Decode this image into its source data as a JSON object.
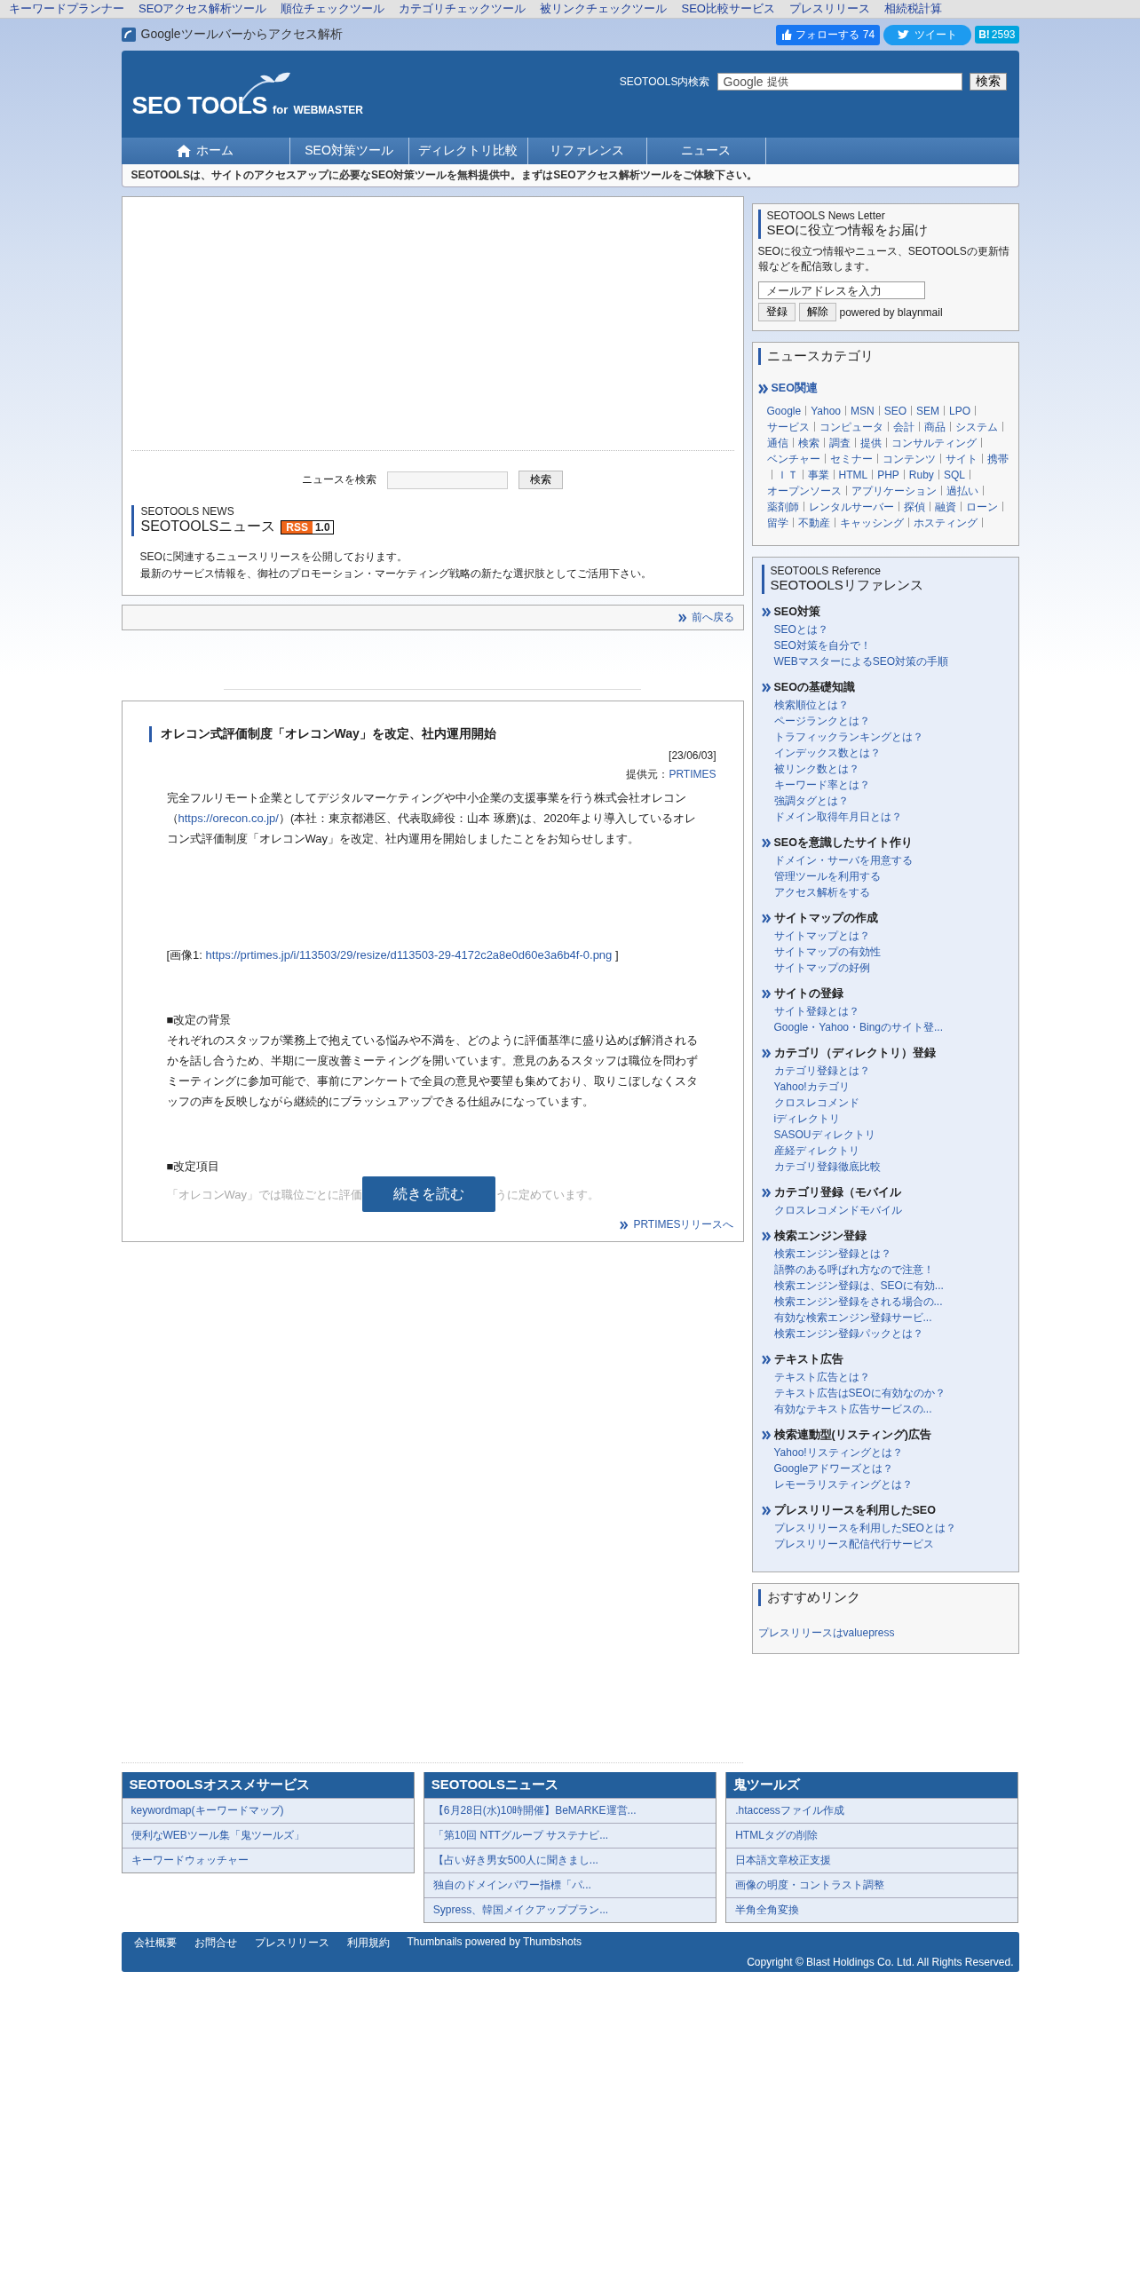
{
  "top_links": [
    "キーワードプランナー",
    "SEOアクセス解析ツール",
    "順位チェックツール",
    "カテゴリチェックツール",
    "被リンクチェックツール",
    "SEO比較サービス",
    "プレスリリース",
    "相続税計算"
  ],
  "toolbar_link": "Googleツールバーからアクセス解析",
  "social": {
    "follow": "フォローする",
    "follow_count": "74",
    "tweet": "ツイート",
    "hatena": "B!",
    "hatena_count": "2593"
  },
  "header": {
    "logo_main": "SEO TOOLS",
    "logo_for": "for",
    "logo_sub": "WEBMASTER",
    "search_label": "SEOTOOLS内検索",
    "search_brand": "Google",
    "search_brand_note": "提供",
    "search_button": "検索"
  },
  "nav": [
    {
      "label": "ホーム",
      "kind": "home"
    },
    {
      "label": "SEO対策ツール",
      "kind": "link"
    },
    {
      "label": "ディレクトリ比較",
      "kind": "link"
    },
    {
      "label": "リファレンス",
      "kind": "link"
    },
    {
      "label": "ニュース",
      "kind": "link"
    }
  ],
  "tagline": "SEOTOOLSは、サイトのアクセスアップに必要なSEO対策ツールを無料提供中。まずはSEOアクセス解析ツールをご体験下さい。",
  "news_panel": {
    "search_label": "ニュースを検索",
    "search_button": "検索",
    "kicker": "SEOTOOLS NEWS",
    "title": "SEOTOOLSニュース",
    "rss": "RSS",
    "rss_version": "1.0",
    "intro": [
      "SEOに関連するニュースリリースを公開しております。",
      "最新のサービス情報を、御社のプロモーション・マーケティング戦略の新たな選択肢としてご活用下さい。"
    ],
    "back_link": "前へ戻る"
  },
  "article": {
    "title": "オレコン式評価制度「オレコンWay」を改定、社内運用開始",
    "date": "[23/06/03]",
    "source_label": "提供元：",
    "source": "PRTIMES",
    "blocks": [
      {
        "kind": "text",
        "parts": [
          {
            "text": "完全フルリモート企業としてデジタルマーケティングや中小企業の支援事業を行う株式会社オレコン（",
            "link": false
          },
          {
            "text": "https://orecon.co.jp/",
            "link": true
          },
          {
            "text": "）(本社：東京都港区、代表取締役：山本 琢磨)は、2020年より導入しているオレコン式評価制度「オレコンWay」を改定、社内運用を開始しましたことをお知らせします。",
            "link": false
          }
        ]
      },
      {
        "kind": "image_ref",
        "parts": [
          {
            "text": "[画像1: ",
            "link": false
          },
          {
            "text": "https://prtimes.jp/i/113503/29/resize/d113503-29-4172c2a8e0d60e3a6b4f-0.png",
            "link": true
          },
          {
            "text": " ]",
            "link": false
          }
        ]
      },
      {
        "kind": "heading",
        "parts": [
          {
            "text": "■改定の背景",
            "link": false
          }
        ]
      },
      {
        "kind": "text",
        "parts": [
          {
            "text": "それぞれのスタッフが業務上で抱えている悩みや不満を、どのように評価基準に盛り込めば解消されるかを話し合うため、半期に一度改善ミーティングを開いています。意見のあるスタッフは職位を問わずミーティングに参加可能で、事前にアンケートで全員の意見や要望も集めており、取りこぼしなくスタッフの声を反映しながら継続的にブラッシュアップできる仕組みになっています。",
            "link": false
          }
        ]
      },
      {
        "kind": "heading",
        "parts": [
          {
            "text": "■改定項目",
            "link": false
          }
        ]
      }
    ],
    "fade_before": "「オレコンWay」では職位ごとに評価",
    "fade_after": "うに定めています。",
    "read_more": "続きを読む",
    "more_link": "PRTIMESリリースへ"
  },
  "newsletter": {
    "kicker": "SEOTOOLS News Letter",
    "title": "SEOに役立つ情報をお届け",
    "description": "SEOに役立つ情報やニュース、SEOTOOLSの更新情報などを配信致します。",
    "email_placeholder": "メールアドレスを入力",
    "buttons": [
      "登録",
      "解除"
    ],
    "powered": "powered by blaynmail"
  },
  "categories": {
    "title": "ニュースカテゴリ",
    "group": "SEO関連",
    "tags": [
      "Google",
      "Yahoo",
      "MSN",
      "SEO",
      "SEM",
      "LPO",
      "サービス",
      "コンピュータ",
      "会計",
      "商品",
      "システム",
      "通信",
      "検索",
      "調査",
      "提供",
      "コンサルティング",
      "ベンチャー",
      "セミナー",
      "コンテンツ",
      "サイト",
      "携帯",
      "ＩＴ",
      "事業",
      "HTML",
      "PHP",
      "Ruby",
      "SQL",
      "オープンソース",
      "アプリケーション",
      "過払い",
      "薬剤師",
      "レンタルサーバー",
      "探偵",
      "融資",
      "ローン",
      "留学",
      "不動産",
      "キャッシング",
      "ホスティング"
    ]
  },
  "reference": {
    "kicker": "SEOTOOLS Reference",
    "title": "SEOTOOLSリファレンス",
    "sections": [
      {
        "heading": "SEO対策",
        "links": [
          "SEOとは？",
          "SEO対策を自分で！",
          "WEBマスターによるSEO対策の手順"
        ]
      },
      {
        "heading": "SEOの基礎知識",
        "links": [
          "検索順位とは？",
          "ページランクとは？",
          "トラフィックランキングとは？",
          "インデックス数とは？",
          "被リンク数とは？",
          "キーワード率とは？",
          "強調タグとは？",
          "ドメイン取得年月日とは？"
        ]
      },
      {
        "heading": "SEOを意識したサイト作り",
        "links": [
          "ドメイン・サーバを用意する",
          "管理ツールを利用する",
          "アクセス解析をする"
        ]
      },
      {
        "heading": "サイトマップの作成",
        "links": [
          "サイトマップとは？",
          "サイトマップの有効性",
          "サイトマップの好例"
        ]
      },
      {
        "heading": "サイトの登録",
        "links": [
          "サイト登録とは？",
          "Google・Yahoo・Bingのサイト登..."
        ]
      },
      {
        "heading": "カテゴリ（ディレクトリ）登録",
        "links": [
          "カテゴリ登録とは？",
          "Yahoo!カテゴリ",
          "クロスレコメンド",
          "iディレクトリ",
          "SASOUディレクトリ",
          "産経ディレクトリ",
          "カテゴリ登録徹底比較"
        ]
      },
      {
        "heading": "カテゴリ登録（モバイル",
        "links": [
          "クロスレコメンドモバイル"
        ]
      },
      {
        "heading": "検索エンジン登録",
        "links": [
          "検索エンジン登録とは？",
          "語弊のある呼ばれ方なので注意！",
          "検索エンジン登録は、SEOに有効...",
          "検索エンジン登録をされる場合の...",
          "有効な検索エンジン登録サービ...",
          "検索エンジン登録パックとは？"
        ]
      },
      {
        "heading": "テキスト広告",
        "links": [
          "テキスト広告とは？",
          "テキスト広告はSEOに有効なのか？",
          "有効なテキスト広告サービスの..."
        ]
      },
      {
        "heading": "検索連動型(リスティング)広告",
        "links": [
          "Yahoo!リスティングとは？",
          "Googleアドワーズとは？",
          "レモーラリスティングとは？"
        ]
      },
      {
        "heading": "プレスリリースを利用したSEO",
        "links": [
          "プレスリリースを利用したSEOとは？",
          "プレスリリース配信代行サービス"
        ]
      }
    ]
  },
  "recommended": {
    "title": "おすすめリンク",
    "links": [
      "プレスリリースはvaluepress"
    ]
  },
  "footer_columns": [
    {
      "title": "SEOTOOLSオススメサービス",
      "links": [
        "keywordmap(キーワードマップ)",
        "便利なWEBツール集「鬼ツールズ」",
        "キーワードウォッチャー"
      ]
    },
    {
      "title": "SEOTOOLSニュース",
      "links": [
        "【6月28日(水)10時開催】BeMARKE運営...",
        "「第10回 NTTグループ サステナビ...",
        "【占い好き男女500人に聞きまし...",
        "独自のドメインパワー指標「パ...",
        "Sypress、韓国メイクアッププラン..."
      ]
    },
    {
      "title": "鬼ツールズ",
      "links": [
        ".htaccessファイル作成",
        "HTMLタグの削除",
        "日本語文章校正支援",
        "画像の明度・コントラスト調整",
        "半角全角変換"
      ]
    }
  ],
  "footer_bar": {
    "links": [
      "会社概要",
      "お問合せ",
      "プレスリリース",
      "利用規約"
    ],
    "thumbnails": "Thumbnails powered by Thumbshots",
    "copyright": "Copyright © Blast Holdings Co. Ltd. All Rights Reserved."
  }
}
